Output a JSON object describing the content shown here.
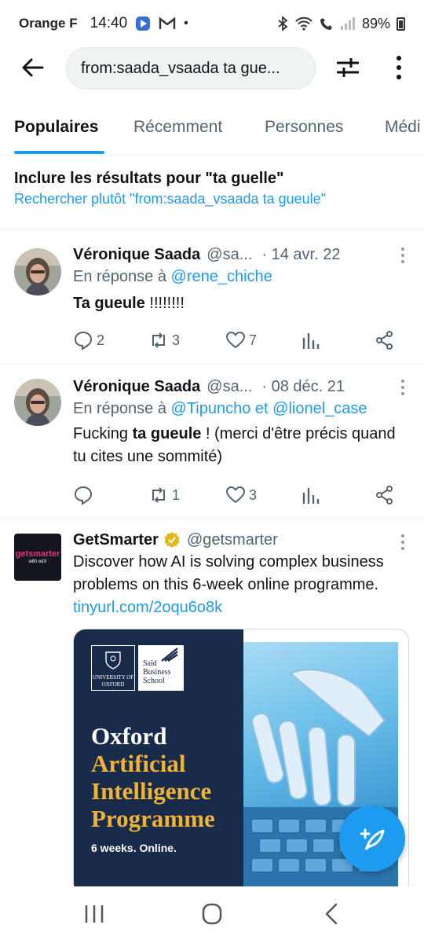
{
  "status_bar": {
    "carrier": "Orange F",
    "time": "14:40",
    "battery": "89%"
  },
  "search": {
    "query": "from:saada_vsaada ta gue..."
  },
  "tabs": [
    {
      "label": "Populaires",
      "active": true
    },
    {
      "label": "Récemment",
      "active": false
    },
    {
      "label": "Personnes",
      "active": false
    },
    {
      "label": "Médi",
      "active": false
    }
  ],
  "spell": {
    "title": "Inclure les résultats pour \"ta guelle\"",
    "link": "Rechercher plutôt \"from:saada_vsaada ta gueule\""
  },
  "tweets": [
    {
      "name": "Véronique Saada",
      "handle": "@sa...",
      "date": "· 14 avr. 22",
      "reply_prefix": "En réponse à ",
      "reply_to": "@rene_chiche",
      "reply_join": "",
      "reply_to2": "",
      "text_bold": "Ta gueule",
      "text_after": " !!!!!!!!",
      "replies": "2",
      "retweets": "3",
      "likes": "7"
    },
    {
      "name": "Véronique Saada",
      "handle": "@sa...",
      "date": "· 08 déc. 21",
      "reply_prefix": "En réponse à ",
      "reply_to": "@Tipuncho",
      "reply_join": " et ",
      "reply_to2": "@lionel_case",
      "text_before": "Fucking ",
      "text_bold": "ta gueule",
      "text_after": " ! (merci d'être précis quand tu cites une sommité)",
      "replies": "",
      "retweets": "1",
      "likes": "3"
    },
    {
      "name": "GetSmarter",
      "handle": "@getsmarter",
      "verified_color": "#e2b719",
      "text": "Discover how AI is solving complex business problems on this 6-week online programme. ",
      "link": "tinyurl.com/2oqu6o8k",
      "avatar_text": "getsmarter",
      "avatar_sub": "with edX"
    }
  ],
  "promo": {
    "oxford_logo": "UNIVERSITY OF OXFORD",
    "said_logo": "Saïd Business School",
    "title_line1": "Oxford",
    "title_line2": "Artificial",
    "title_line3": "Intelligence",
    "title_line4": "Programme",
    "subtitle": "6 weeks. Online.",
    "colors": {
      "navy": "#182b4a",
      "gold": "#f2b233"
    }
  },
  "colors": {
    "accent": "#1d9bf0",
    "secondary_text": "#536471"
  }
}
